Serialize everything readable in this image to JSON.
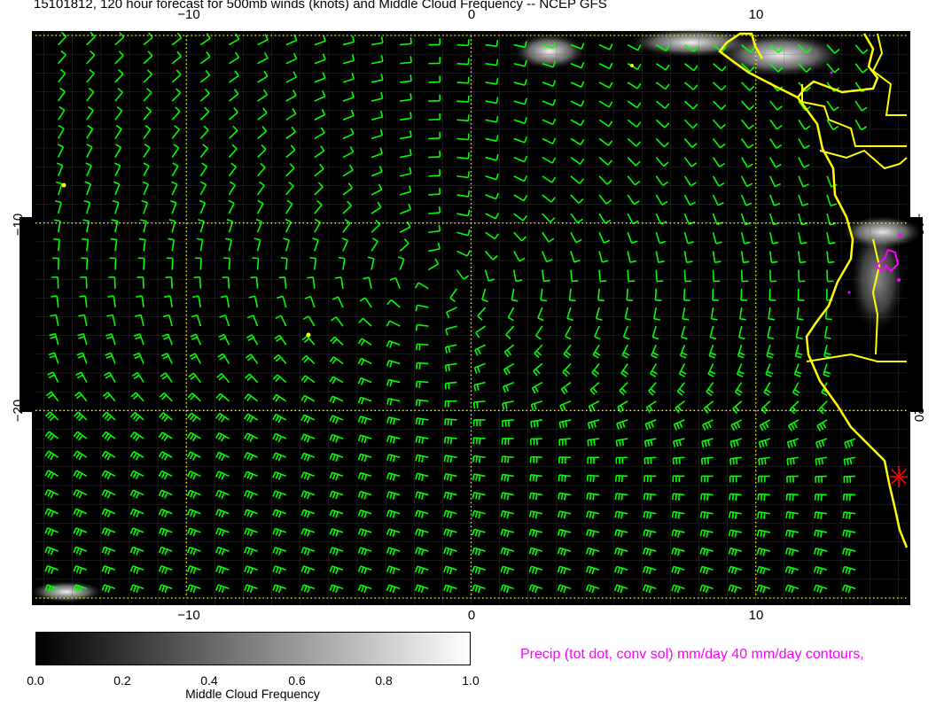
{
  "title": "15101812, 120 hour forecast for 500mb winds (knots) and Middle Cloud Frequency -- NCEP GFS",
  "chart_data": {
    "type": "wind-barb map",
    "title": "15101812, 120 hour forecast for 500mb winds (knots) and Middle Cloud Frequency -- NCEP GFS",
    "x_axis": {
      "range": [
        -15.3,
        15.3
      ],
      "ticks": [
        -10,
        0,
        10
      ],
      "tick_labels": [
        "−10",
        "0",
        "10"
      ]
    },
    "y_axis": {
      "range": [
        -30,
        0
      ],
      "ticks": [
        -10,
        -20
      ],
      "tick_labels": [
        "−10",
        "−20"
      ]
    },
    "gridlines_dotted": {
      "x": [
        -10,
        0,
        10
      ],
      "y": [
        0,
        -10,
        -20,
        -30
      ]
    },
    "grid_color": "#ffff00",
    "background": "#000000",
    "wind_barb_color": "#00ff00",
    "coastline_color": "#ffff00",
    "precip_contour_color": "#ff00ff",
    "storm_marker_color": "#ff0000",
    "colorbar": {
      "label": "Middle Cloud Frequency",
      "ticks": [
        0.0,
        0.2,
        0.4,
        0.6,
        0.8,
        1.0
      ],
      "tick_labels": [
        "0.0",
        "0.2",
        "0.4",
        "0.6",
        "0.8",
        "1.0"
      ],
      "range": [
        0,
        1
      ]
    },
    "precip_legend": "Precip (tot dot, conv sol) mm/day 40 mm/day contours,"
  }
}
